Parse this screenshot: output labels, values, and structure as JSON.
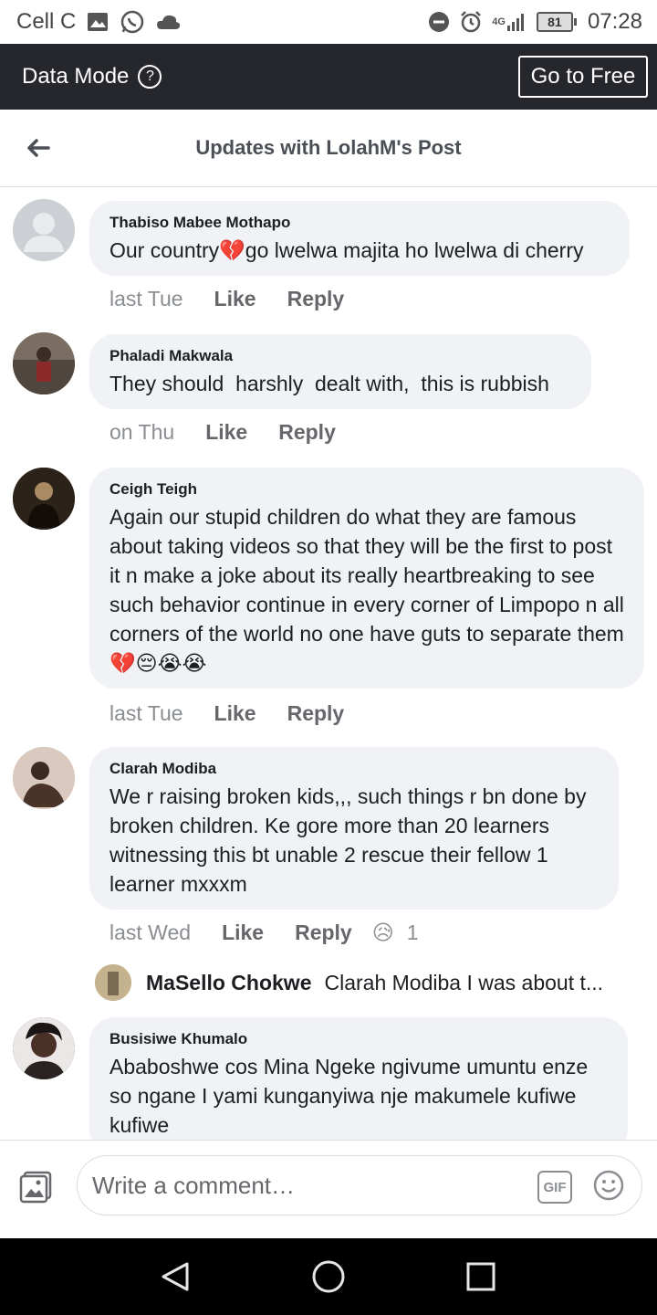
{
  "status_bar": {
    "carrier": "Cell C",
    "network": "4G",
    "battery": "81",
    "time": "07:28"
  },
  "data_bar": {
    "label": "Data Mode",
    "help": "?",
    "go_free": "Go to Free"
  },
  "header": {
    "title": "Updates with LolahM's Post"
  },
  "comments": [
    {
      "author": "Thabiso Mabee Mothapo",
      "text": "Our country💔go lwelwa majita ho lwelwa di cherry",
      "time": "last Tue",
      "like": "Like",
      "reply": "Reply"
    },
    {
      "author": "Phaladi Makwala",
      "text": "They should  harshly  dealt with,  this is rubbish",
      "time": "on Thu",
      "like": "Like",
      "reply": "Reply"
    },
    {
      "author": "Ceigh Teigh",
      "text": "Again our stupid children do what they are famous about taking videos so that they will be the first to post it n make a joke about its really heartbreaking to see such behavior continue in every corner of Limpopo n all corners of the world no one have guts to separate them💔😔😭😭",
      "time": "last Tue",
      "like": "Like",
      "reply": "Reply"
    },
    {
      "author": "Clarah Modiba",
      "text": "We r raising broken kids,,, such things r bn done by broken children. Ke gore more than 20 learners witnessing this bt unable 2 rescue their fellow 1 learner mxxxm",
      "time": "last Wed",
      "like": "Like",
      "reply": "Reply",
      "reaction_emoji": "😥",
      "reaction_count": "1",
      "reply_preview": {
        "author": "MaSello Chokwe",
        "text": "Clarah Modiba I was about t..."
      }
    },
    {
      "author": "Busisiwe Khumalo",
      "text": "Ababoshwe cos Mina Ngeke ngivume umuntu enze so ngane I yami kunganyiwa nje makumele kufiwe kufiwe"
    }
  ],
  "composer": {
    "placeholder": "Write a comment…",
    "gif": "GIF"
  },
  "icons": {
    "back": "arrow-left-icon",
    "photo": "photo-icon",
    "emoji": "emoji-icon",
    "nav_back": "nav-back-icon",
    "nav_home": "nav-home-icon",
    "nav_recents": "nav-recents-icon"
  },
  "colors": {
    "data_bar_bg": "#25272c",
    "bubble_bg": "#f0f2f5",
    "action_text": "#65676b",
    "timestamp": "#8a8d91"
  }
}
